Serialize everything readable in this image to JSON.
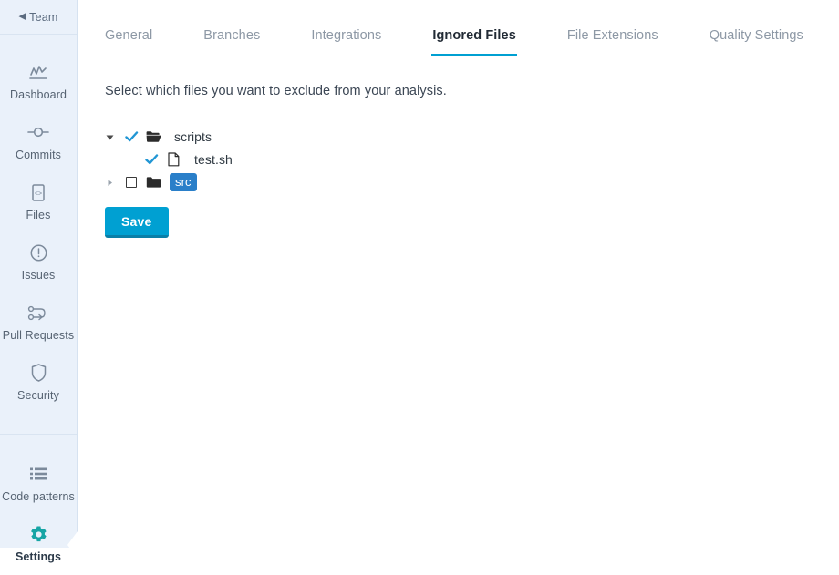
{
  "sidebar": {
    "team_label": "Team",
    "back_chevron": "chevron-left-icon",
    "groups": [
      {
        "items": [
          {
            "label": "Dashboard",
            "icon": "dashboard-chart-icon",
            "active": false
          },
          {
            "label": "Commits",
            "icon": "commit-node-icon",
            "active": false
          },
          {
            "label": "Files",
            "icon": "code-file-icon",
            "active": false
          },
          {
            "label": "Issues",
            "icon": "exclamation-circle-icon",
            "active": false
          },
          {
            "label": "Pull Requests",
            "icon": "pull-request-icon",
            "active": false
          },
          {
            "label": "Security",
            "icon": "shield-icon",
            "active": false
          }
        ]
      },
      {
        "items": [
          {
            "label": "Code patterns",
            "icon": "list-lines-icon",
            "active": false
          },
          {
            "label": "Settings",
            "icon": "gear-icon",
            "active": true
          }
        ]
      }
    ]
  },
  "tabs": [
    {
      "label": "General",
      "active": false
    },
    {
      "label": "Branches",
      "active": false
    },
    {
      "label": "Integrations",
      "active": false
    },
    {
      "label": "Ignored Files",
      "active": true
    },
    {
      "label": "File Extensions",
      "active": false
    },
    {
      "label": "Quality Settings",
      "active": false
    }
  ],
  "main": {
    "description": "Select which files you want to exclude from your analysis.",
    "save_label": "Save"
  },
  "tree": [
    {
      "label": "scripts",
      "type": "folder",
      "icon": "folder-open-icon",
      "expanded": true,
      "twisty": "triangle-down-icon",
      "checked": true,
      "check_icon": "check-mark-icon",
      "indent": 0,
      "selected": false
    },
    {
      "label": "test.sh",
      "type": "file",
      "icon": "file-document-icon",
      "expanded": null,
      "twisty": "",
      "checked": true,
      "check_icon": "check-mark-icon",
      "indent": 1,
      "selected": false
    },
    {
      "label": "src",
      "type": "folder",
      "icon": "folder-closed-icon",
      "expanded": false,
      "twisty": "triangle-right-icon",
      "checked": false,
      "check_icon": "checkbox-empty-icon",
      "indent": 0,
      "selected": true
    }
  ],
  "colors": {
    "accent": "#00a0d2",
    "check_blue": "#2196d4",
    "selected_blue": "#2a7fc9",
    "sidebar_bg": "#eaf1fa",
    "active_nav": "#17a5a5"
  }
}
